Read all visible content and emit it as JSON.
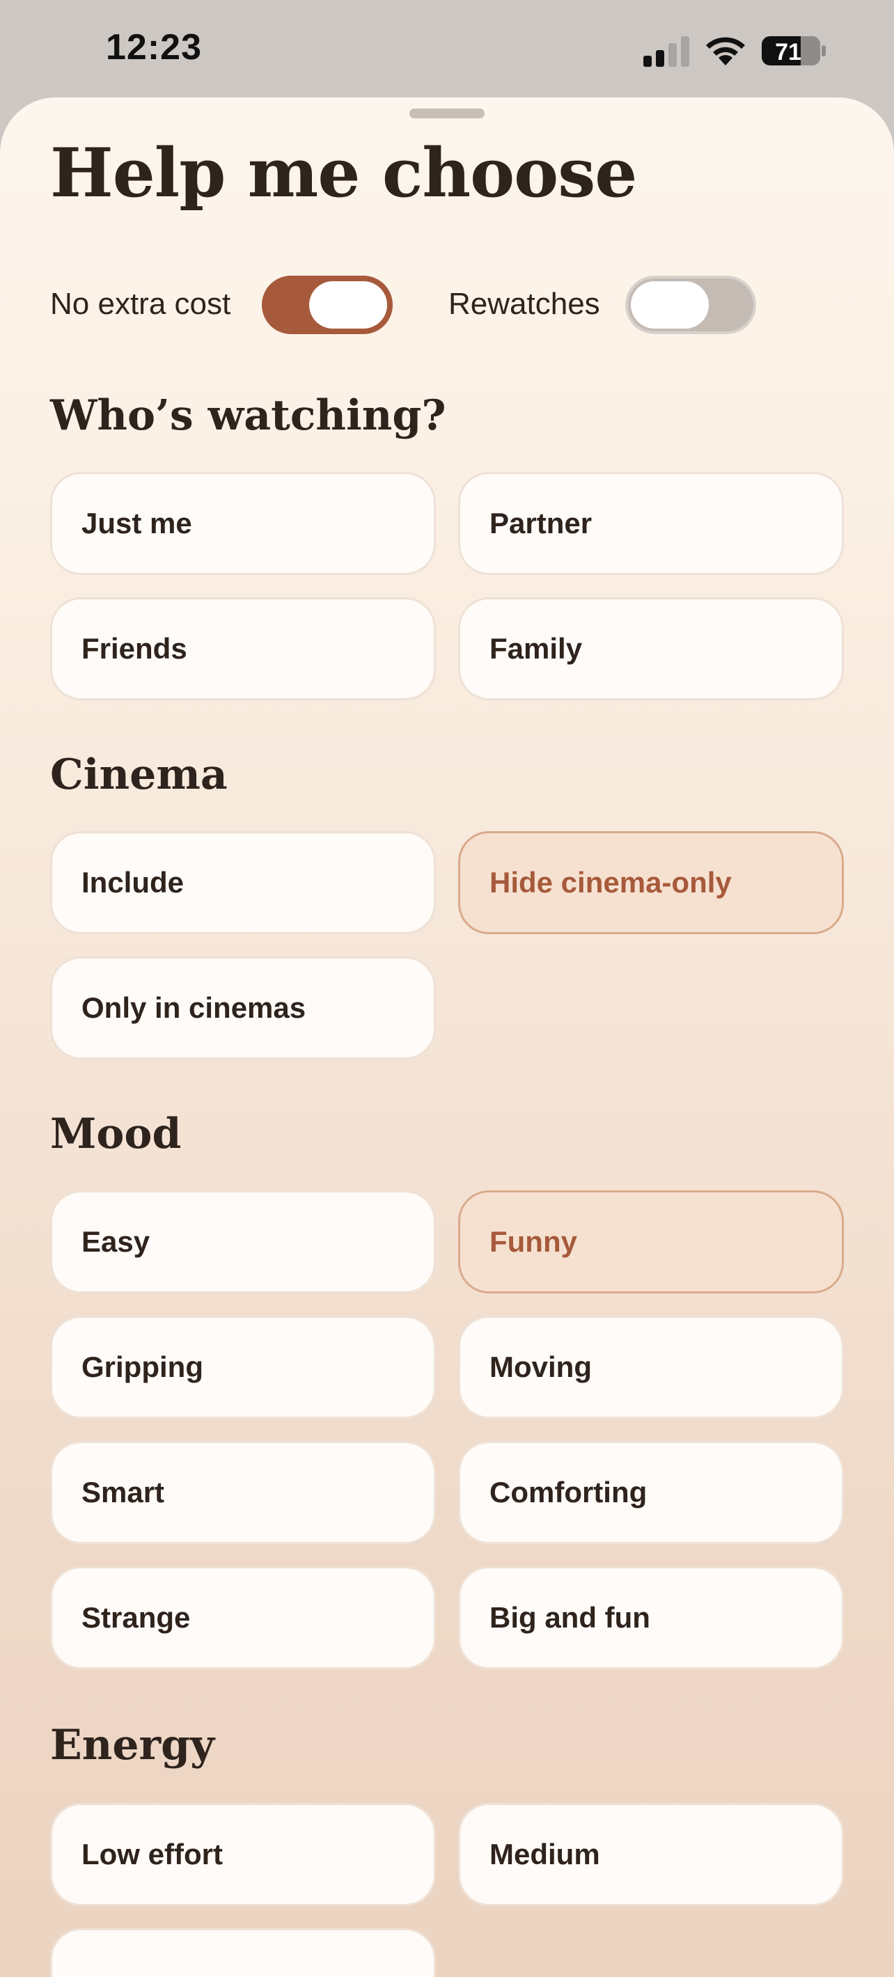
{
  "status": {
    "time": "12:23",
    "battery": "71"
  },
  "sheet": {
    "title": "Help me choose",
    "toggles": [
      {
        "label": "No extra cost",
        "on": true
      },
      {
        "label": "Rewatches",
        "on": false
      }
    ]
  },
  "sections": {
    "watching": {
      "title": "Who’s watching?",
      "options": [
        "Just me",
        "Partner",
        "Friends",
        "Family"
      ]
    },
    "cinema": {
      "title": "Cinema",
      "options": [
        "Include",
        "Hide cinema-only",
        "Only in cinemas"
      ],
      "selected": "Hide cinema-only"
    },
    "mood": {
      "title": "Mood",
      "options": [
        "Easy",
        "Funny",
        "Gripping",
        "Moving",
        "Smart",
        "Comforting",
        "Strange",
        "Big and fun"
      ],
      "selected": "Funny"
    },
    "energy": {
      "title": "Energy",
      "options": [
        "Low effort",
        "Medium"
      ]
    }
  },
  "colors": {
    "accent": "#a65a3b",
    "selected_chip_bg": "#f6e1d1",
    "chip_bg": "#fefbf8",
    "text": "#2e231d"
  }
}
